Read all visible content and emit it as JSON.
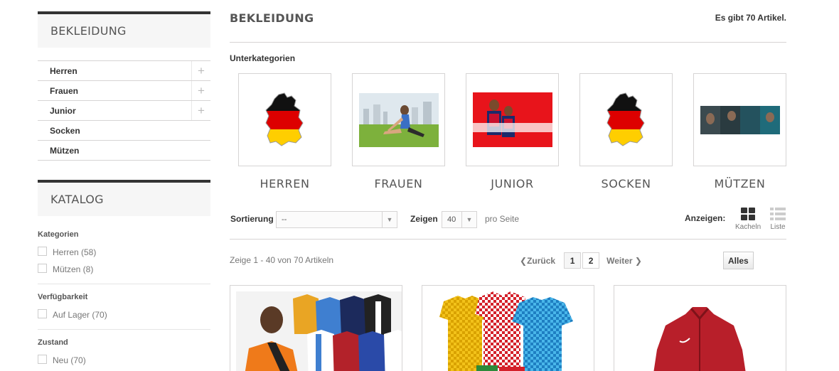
{
  "sidebar": {
    "categories_title": "BEKLEIDUNG",
    "categories": [
      {
        "label": "Herren",
        "expandable": true
      },
      {
        "label": "Frauen",
        "expandable": true
      },
      {
        "label": "Junior",
        "expandable": true
      },
      {
        "label": "Socken",
        "expandable": false
      },
      {
        "label": "Mützen",
        "expandable": false
      }
    ],
    "expand_symbol": "+",
    "catalog_title": "KATALOG",
    "filters": {
      "kategorien": {
        "title": "Kategorien",
        "options": [
          "Herren (58)",
          "Mützen (8)"
        ]
      },
      "verfuegbarkeit": {
        "title": "Verfügbarkeit",
        "options": [
          "Auf Lager (70)"
        ]
      },
      "zustand": {
        "title": "Zustand",
        "options": [
          "Neu (70)"
        ]
      }
    }
  },
  "main": {
    "title": "BEKLEIDUNG",
    "count_text": "Es gibt 70 Artikel.",
    "subcategories_heading": "Unterkategorien",
    "subcategories": [
      {
        "name": "HERREN",
        "thumb_icon": "germany-flag-map"
      },
      {
        "name": "FRAUEN",
        "thumb_icon": "woman-stretching-photo"
      },
      {
        "name": "JUNIOR",
        "thumb_icon": "junior-players-photo",
        "thumb_caption": "Junior"
      },
      {
        "name": "SOCKEN",
        "thumb_icon": "germany-flag-map"
      },
      {
        "name": "MÜTZEN",
        "thumb_icon": "beanie-banner",
        "thumb_caption": "MÜTZEN"
      }
    ],
    "sort": {
      "label": "Sortierung",
      "value": "--"
    },
    "show": {
      "label": "Zeigen",
      "value": "40",
      "suffix": "pro Seite"
    },
    "view": {
      "label": "Anzeigen:",
      "grid_label": "Kacheln",
      "list_label": "Liste",
      "active": "grid"
    },
    "showing_text": "Zeige 1 - 40 von 70 Artikeln",
    "pagination": {
      "prev": "Zurück",
      "pages": [
        "1",
        "2"
      ],
      "current": "1",
      "next": "Weiter",
      "all": "Alles"
    },
    "products": [
      {
        "image": "jerseys-collage-with-player"
      },
      {
        "image": "checkered-jerseys"
      },
      {
        "image": "red-jacket"
      }
    ]
  },
  "colors": {
    "accent": "#333333",
    "border": "#d6d4d4",
    "block_bg": "#f6f6f6",
    "flag_black": "#000000",
    "flag_red": "#dd0000",
    "flag_gold": "#ffce00"
  }
}
